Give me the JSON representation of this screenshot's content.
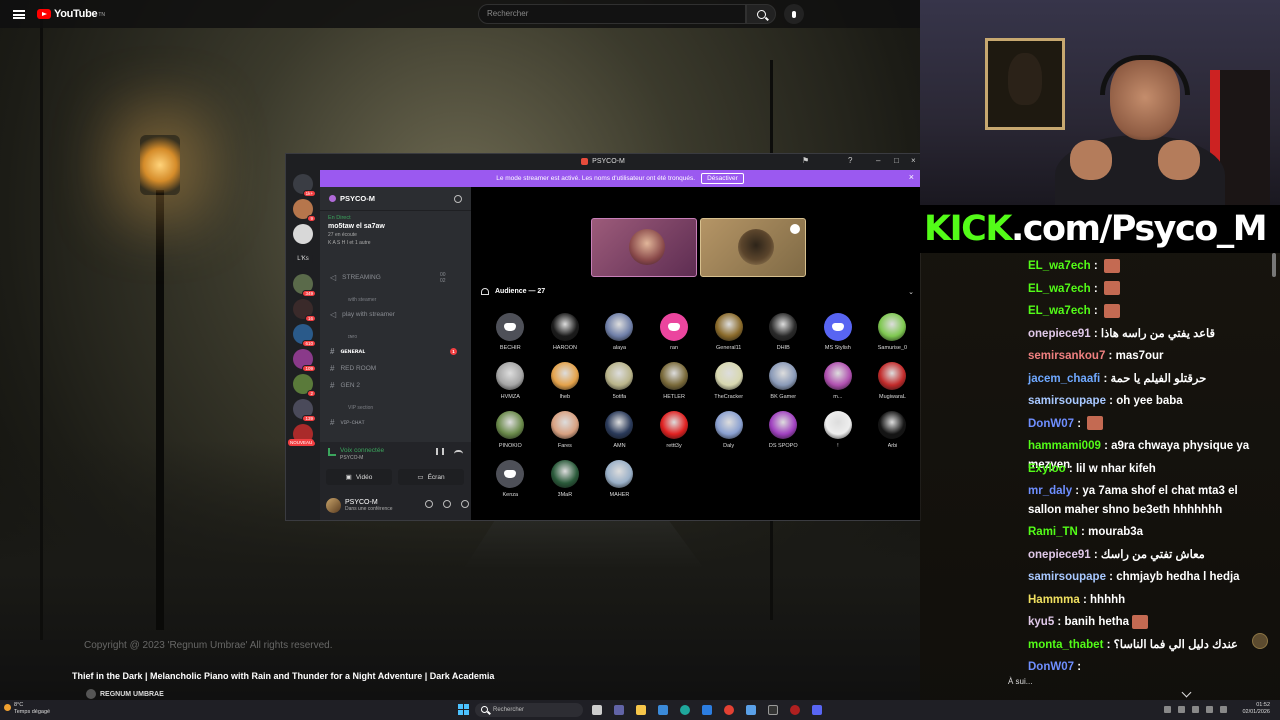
{
  "youtube": {
    "logo_text": "YouTube",
    "logo_sup": "TN",
    "search_placeholder": "Rechercher",
    "copyright": "Copyright @ 2023 'Regnum Umbrae' All rights reserved.",
    "video_title": "Thief in the Dark | Melancholic Piano with Rain and Thunder for a Night Adventure | Dark Academia",
    "channel_name": "REGNUM UMBRAE"
  },
  "discord": {
    "window_title": "PSYCO-M",
    "banner_text": "Le mode streamer est activé. Les noms d'utilisateur ont été tronqués.",
    "banner_button": "Désactiver",
    "guild_name": "PSYCO-M",
    "live": {
      "status": "En Direct",
      "title": "mo5taw el sa7aw",
      "sub": "27 en écoute",
      "users": "K A S H I et 1 autre"
    },
    "servers": [
      {
        "badge": "1k+"
      },
      {
        "badge": "9"
      },
      {
        "badge": ""
      },
      {
        "label": "L'Ks"
      },
      {
        "badge": "349"
      },
      {
        "badge": "16"
      },
      {
        "badge": "610"
      },
      {
        "badge": "109"
      },
      {
        "badge": "2"
      },
      {
        "badge": "139"
      },
      {
        "badge": "4"
      }
    ],
    "new_label": "NOUVEAU",
    "channels": {
      "streaming": "STREAMING",
      "streaming_count": "00  02",
      "with_streamer_cat": "with steamer",
      "play_with_streamer": "play with streamer",
      "cat_2": "ɪɴғᴏ",
      "general": "ɢᴇɴᴇʀᴀʟ",
      "red_room": "RED ROOM",
      "gen2": "GEN 2",
      "vip_section": "VIP section",
      "vip_chat": "ᴠɪᴘ-ᴄʜᴀᴛ",
      "unread_count": "1"
    },
    "voice": {
      "connected": "Voix connectée",
      "sub": "PSYCO-M",
      "video_btn": "Vidéo",
      "screen_btn": "Écran"
    },
    "user": {
      "name": "PSYCO-M",
      "status": "Dans une conférence"
    },
    "audience_label": "Audience — 27",
    "audience": [
      {
        "name": "BECHIR",
        "style": "grey",
        "color": ""
      },
      {
        "name": "HAROON",
        "style": "photo",
        "color": "#1b1b1b"
      },
      {
        "name": "alaya",
        "style": "photo",
        "color": "#6f7fa8"
      },
      {
        "name": "ran",
        "style": "discord",
        "color": "#eb459e"
      },
      {
        "name": "General11",
        "style": "photo",
        "color": "#8a6a2a"
      },
      {
        "name": "DHIB",
        "style": "photo",
        "color": "#2a2a2a"
      },
      {
        "name": "MS Stylish",
        "style": "discord",
        "color": "#5865f2"
      },
      {
        "name": "Samurise_0",
        "style": "photo",
        "color": "#7ec850"
      },
      {
        "name": "HVMZA",
        "style": "photo",
        "color": "#a6a6a6"
      },
      {
        "name": "lheb",
        "style": "photo",
        "color": "#e4a24a"
      },
      {
        "name": "5otifa",
        "style": "photo",
        "color": "#b9b48a"
      },
      {
        "name": "HETLER",
        "style": "photo",
        "color": "#7a6a3a"
      },
      {
        "name": "TheCracker",
        "style": "photo",
        "color": "#d8d8b0"
      },
      {
        "name": "BK Gamer",
        "style": "photo",
        "color": "#8a9ab8"
      },
      {
        "name": "m...",
        "style": "photo",
        "color": "#b050b0"
      },
      {
        "name": "MugiwaraL",
        "style": "photo",
        "color": "#c22a2a"
      },
      {
        "name": "PINOKIO",
        "style": "photo",
        "color": "#6a8a4a"
      },
      {
        "name": "Fares",
        "style": "photo",
        "color": "#d8a080"
      },
      {
        "name": "AMN",
        "style": "photo",
        "color": "#2a3a5a"
      },
      {
        "name": "rettt3y",
        "style": "photo",
        "color": "#e02020"
      },
      {
        "name": "Daly",
        "style": "photo",
        "color": "#8aa0d0"
      },
      {
        "name": "DS SPOPO",
        "style": "photo",
        "color": "#a040c0"
      },
      {
        "name": "!",
        "style": "photo",
        "color": "#eeeeee"
      },
      {
        "name": "Arbi",
        "style": "photo",
        "color": "#151515"
      },
      {
        "name": "Kenza",
        "style": "grey",
        "color": ""
      },
      {
        "name": "3MaR",
        "style": "photo",
        "color": "#2a5a3a"
      },
      {
        "name": "MAHER",
        "style": "photo",
        "color": "#9ab0c8"
      }
    ]
  },
  "kick": {
    "brand": "KICK",
    "rest": ".com/Psyco_M"
  },
  "chat": [
    {
      "user": "EL_wa7ech",
      "color": "#53fc18",
      "text": "",
      "emote": true
    },
    {
      "user": "EL_wa7ech",
      "color": "#53fc18",
      "text": "",
      "emote": true
    },
    {
      "user": "EL_wa7ech",
      "color": "#53fc18",
      "text": "",
      "emote": true
    },
    {
      "user": "onepiece91",
      "color": "#e0c8e8",
      "text": "قاعد يفتي من راسه هاذا",
      "emote": false
    },
    {
      "user": "semirsankou7",
      "color": "#f08080",
      "text": "mas7our",
      "emote": false
    },
    {
      "user": "jacem_chaafi",
      "color": "#6fa8ff",
      "text": "حرقتلو الفيلم يا حمة",
      "emote": false
    },
    {
      "user": "samirsoupape",
      "color": "#a8c8ff",
      "text": "oh yee baba",
      "emote": false
    },
    {
      "user": "DonW07",
      "color": "#6f8fff",
      "text": "",
      "emote": true
    },
    {
      "user": "hammami009",
      "color": "#53fc18",
      "text": "a9ra chwaya physique ya mezyen",
      "emote": false
    },
    {
      "user": "Exyloo",
      "color": "#53fc18",
      "text": "lil w nhar kifeh",
      "emote": false
    },
    {
      "user": "mr_daly",
      "color": "#6f8fff",
      "text": "ya 7ama shof el chat mta3 el sallon maher shno be3eth hhhhhhh",
      "emote": false
    },
    {
      "user": "Rami_TN",
      "color": "#53fc18",
      "text": "mourab3a",
      "emote": false
    },
    {
      "user": "onepiece91",
      "color": "#e0c8e8",
      "text": "معاش تفتي من راسك",
      "emote": false
    },
    {
      "user": "samirsoupape",
      "color": "#a8c8ff",
      "text": "chmjayb hedha l hedja",
      "emote": false
    },
    {
      "user": "Hammma",
      "color": "#f0e060",
      "text": "hhhhh",
      "emote": false
    },
    {
      "user": "kyu5",
      "color": "#e0c8e8",
      "text": "banih hetha",
      "emote": true
    },
    {
      "user": "monta_thabet",
      "color": "#53fc18",
      "text": "عندك دليل الي فما الناسا؟",
      "emote": false
    },
    {
      "user": "DonW07",
      "color": "#6f8fff",
      "text": "",
      "emote": false
    }
  ],
  "chat_bottom": "À sui...",
  "taskbar": {
    "weather_temp": "8°C",
    "weather_desc": "Temps dégagé",
    "search": "Rechercher",
    "time": "01:52",
    "date": "02/01/2026"
  }
}
